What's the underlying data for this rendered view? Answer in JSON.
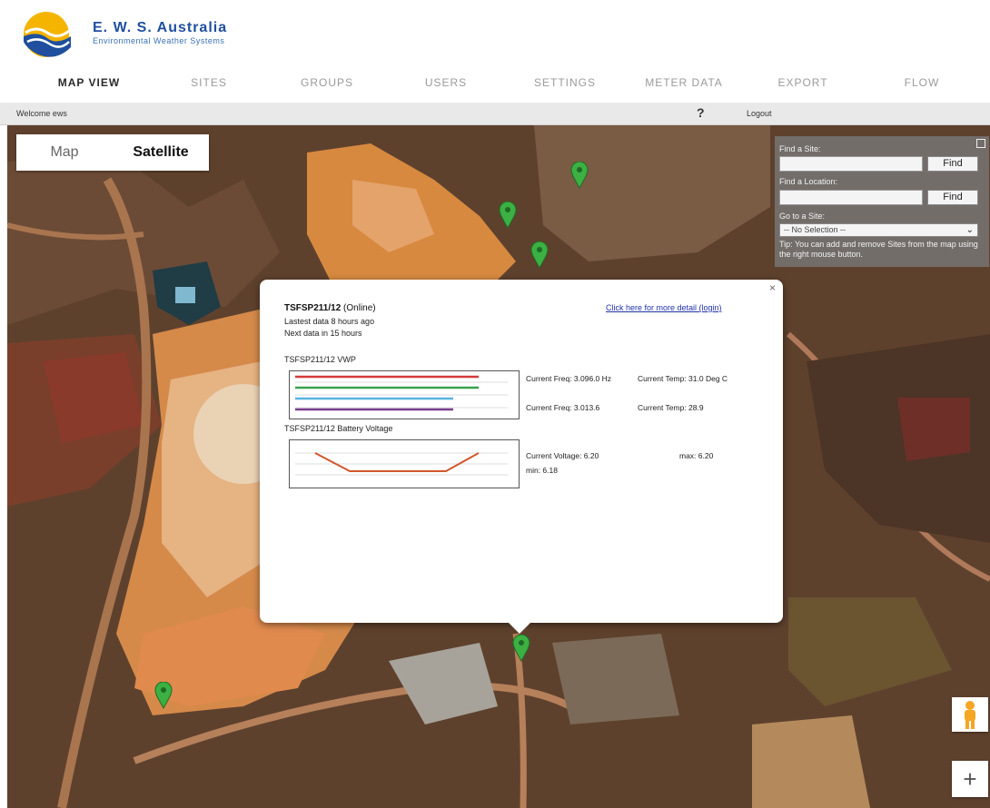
{
  "brand": {
    "name": "E. W. S. Australia",
    "tagline": "Environmental Weather Systems"
  },
  "nav": {
    "items": [
      {
        "label": "MAP VIEW",
        "active": true
      },
      {
        "label": "SITES",
        "active": false
      },
      {
        "label": "GROUPS",
        "active": false
      },
      {
        "label": "USERS",
        "active": false
      },
      {
        "label": "SETTINGS",
        "active": false
      },
      {
        "label": "METER DATA",
        "active": false
      },
      {
        "label": "EXPORT",
        "active": false
      },
      {
        "label": "FLOW",
        "active": false
      }
    ]
  },
  "welcome_bar": {
    "welcome": "Welcome ews",
    "help": "?",
    "logout": "Logout"
  },
  "map_type": {
    "map": "Map",
    "satellite": "Satellite",
    "selected": "Satellite"
  },
  "find_panel": {
    "find_site_label": "Find a Site:",
    "find_location_label": "Find a Location:",
    "find_button": "Find",
    "goto_label": "Go to a Site:",
    "select_value": "-- No Selection --",
    "tip": "Tip: You can add and remove Sites from the map using the right mouse button."
  },
  "popup": {
    "site_id": "TSFSP211/12",
    "status": "(Online)",
    "latest": "Lastest data 8 hours ago",
    "next": "Next data in 15 hours",
    "detail_link": "Click here for more detail (login)",
    "vwp_label": "TSFSP211/12 VWP",
    "vwp_series_colors": [
      "#d43a3a",
      "#3aa14a",
      "#59b4e0",
      "#7a3f8f"
    ],
    "vwp_readings": {
      "freq1": "Current Freq: 3.096.0 Hz",
      "temp1": "Current Temp: 31.0 Deg C",
      "freq2": "Current Freq: 3.013.6",
      "temp2": "Current Temp: 28.9"
    },
    "battery_label": "TSFSP211/12 Battery Voltage",
    "battery_readings": {
      "voltage": "Current Voltage: 6.20",
      "max": "max: 6.20",
      "min": "min: 6.18"
    }
  },
  "colors": {
    "brand_blue": "#1f4f9e",
    "marker_green": "#3cb043",
    "link_blue": "#2233aa"
  }
}
